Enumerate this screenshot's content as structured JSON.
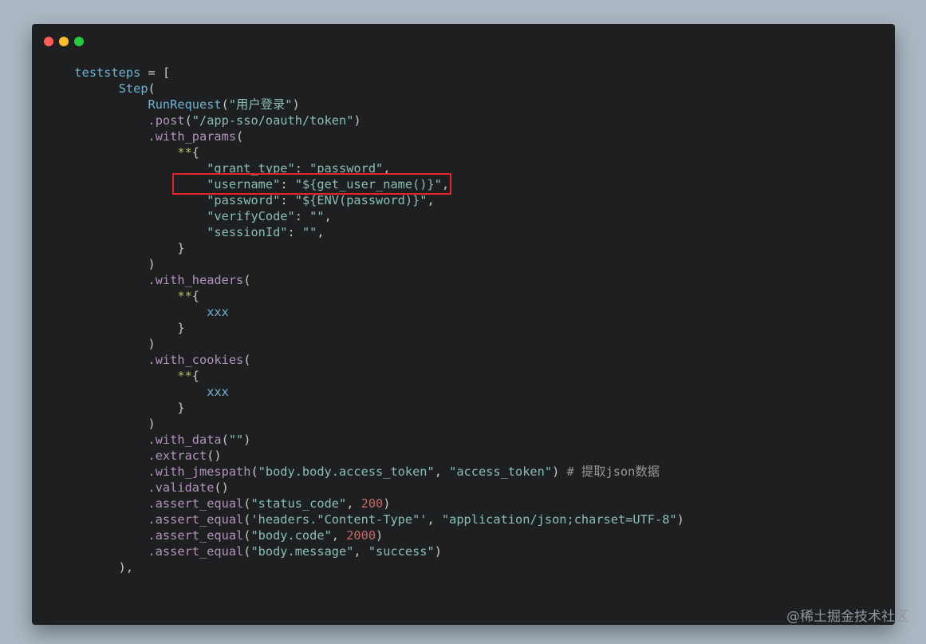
{
  "colors": {
    "background": "#abb8c3",
    "window": "#1d1f21",
    "default": "#c5c8c6",
    "identifier": "#6fb3d2",
    "method": "#b294bb",
    "string": "#8abeb7",
    "number": "#cc6666",
    "operator": "#b5bd68",
    "comment": "#969896",
    "highlight_border": "#e2252b"
  },
  "window_controls": [
    "close",
    "minimize",
    "maximize"
  ],
  "highlight": {
    "line_index": 7
  },
  "watermark": "@稀土掘金技术社区",
  "code_lines": [
    [
      {
        "t": "  "
      },
      {
        "t": "teststeps",
        "c": "identifier"
      },
      {
        "t": " = ["
      }
    ],
    [
      {
        "t": "        "
      },
      {
        "t": "Step",
        "c": "identifier"
      },
      {
        "t": "("
      }
    ],
    [
      {
        "t": "            "
      },
      {
        "t": "RunRequest",
        "c": "identifier"
      },
      {
        "t": "("
      },
      {
        "t": "\"用户登录\"",
        "c": "string"
      },
      {
        "t": ")"
      }
    ],
    [
      {
        "t": "            "
      },
      {
        "t": ".post",
        "c": "method"
      },
      {
        "t": "("
      },
      {
        "t": "\"/app-sso/oauth/token\"",
        "c": "string"
      },
      {
        "t": ")"
      }
    ],
    [
      {
        "t": "            "
      },
      {
        "t": ".with_params",
        "c": "method"
      },
      {
        "t": "("
      }
    ],
    [
      {
        "t": "                "
      },
      {
        "t": "**",
        "c": "operator"
      },
      {
        "t": "{"
      }
    ],
    [
      {
        "t": "                    "
      },
      {
        "t": "\"grant_type\"",
        "c": "string"
      },
      {
        "t": ": "
      },
      {
        "t": "\"password\"",
        "c": "string"
      },
      {
        "t": ","
      }
    ],
    [
      {
        "t": "                    "
      },
      {
        "t": "\"username\"",
        "c": "string"
      },
      {
        "t": ": "
      },
      {
        "t": "\"${get_user_name()}\"",
        "c": "string"
      },
      {
        "t": ","
      }
    ],
    [
      {
        "t": "                    "
      },
      {
        "t": "\"password\"",
        "c": "string"
      },
      {
        "t": ": "
      },
      {
        "t": "\"${ENV(password)}\"",
        "c": "string"
      },
      {
        "t": ","
      }
    ],
    [
      {
        "t": "                    "
      },
      {
        "t": "\"verifyCode\"",
        "c": "string"
      },
      {
        "t": ": "
      },
      {
        "t": "\"\"",
        "c": "string"
      },
      {
        "t": ","
      }
    ],
    [
      {
        "t": "                    "
      },
      {
        "t": "\"sessionId\"",
        "c": "string"
      },
      {
        "t": ": "
      },
      {
        "t": "\"\"",
        "c": "string"
      },
      {
        "t": ","
      }
    ],
    [
      {
        "t": "                }"
      }
    ],
    [
      {
        "t": "            )"
      }
    ],
    [
      {
        "t": "            "
      },
      {
        "t": ".with_headers",
        "c": "method"
      },
      {
        "t": "("
      }
    ],
    [
      {
        "t": "                "
      },
      {
        "t": "**",
        "c": "operator"
      },
      {
        "t": "{"
      }
    ],
    [
      {
        "t": "                    "
      },
      {
        "t": "xxx",
        "c": "identifier"
      }
    ],
    [
      {
        "t": "                }"
      }
    ],
    [
      {
        "t": "            )"
      }
    ],
    [
      {
        "t": "            "
      },
      {
        "t": ".with_cookies",
        "c": "method"
      },
      {
        "t": "("
      }
    ],
    [
      {
        "t": "                "
      },
      {
        "t": "**",
        "c": "operator"
      },
      {
        "t": "{"
      }
    ],
    [
      {
        "t": "                    "
      },
      {
        "t": "xxx",
        "c": "identifier"
      }
    ],
    [
      {
        "t": "                }"
      }
    ],
    [
      {
        "t": "            )"
      }
    ],
    [
      {
        "t": "            "
      },
      {
        "t": ".with_data",
        "c": "method"
      },
      {
        "t": "("
      },
      {
        "t": "\"\"",
        "c": "string"
      },
      {
        "t": ")"
      }
    ],
    [
      {
        "t": "            "
      },
      {
        "t": ".extract",
        "c": "method"
      },
      {
        "t": "()"
      }
    ],
    [
      {
        "t": "            "
      },
      {
        "t": ".with_jmespath",
        "c": "method"
      },
      {
        "t": "("
      },
      {
        "t": "\"body.body.access_token\"",
        "c": "string"
      },
      {
        "t": ", "
      },
      {
        "t": "\"access_token\"",
        "c": "string"
      },
      {
        "t": ") "
      },
      {
        "t": "# 提取json数据",
        "c": "comment"
      }
    ],
    [
      {
        "t": "            "
      },
      {
        "t": ".validate",
        "c": "method"
      },
      {
        "t": "()"
      }
    ],
    [
      {
        "t": "            "
      },
      {
        "t": ".assert_equal",
        "c": "method"
      },
      {
        "t": "("
      },
      {
        "t": "\"status_code\"",
        "c": "string"
      },
      {
        "t": ", "
      },
      {
        "t": "200",
        "c": "number"
      },
      {
        "t": ")"
      }
    ],
    [
      {
        "t": "            "
      },
      {
        "t": ".assert_equal",
        "c": "method"
      },
      {
        "t": "("
      },
      {
        "t": "'headers.\"Content-Type\"'",
        "c": "string"
      },
      {
        "t": ", "
      },
      {
        "t": "\"application/json;charset=UTF-8\"",
        "c": "string"
      },
      {
        "t": ")"
      }
    ],
    [
      {
        "t": "            "
      },
      {
        "t": ".assert_equal",
        "c": "method"
      },
      {
        "t": "("
      },
      {
        "t": "\"body.code\"",
        "c": "string"
      },
      {
        "t": ", "
      },
      {
        "t": "2000",
        "c": "number"
      },
      {
        "t": ")"
      }
    ],
    [
      {
        "t": "            "
      },
      {
        "t": ".assert_equal",
        "c": "method"
      },
      {
        "t": "("
      },
      {
        "t": "\"body.message\"",
        "c": "string"
      },
      {
        "t": ", "
      },
      {
        "t": "\"success\"",
        "c": "string"
      },
      {
        "t": ")"
      }
    ],
    [
      {
        "t": "        ),"
      }
    ]
  ]
}
